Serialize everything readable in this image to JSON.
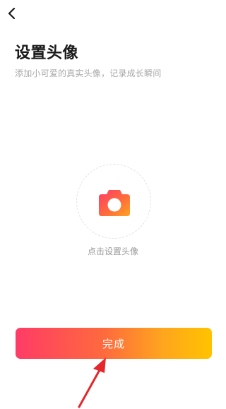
{
  "nav": {
    "back_icon": "chevron-left-icon"
  },
  "header": {
    "title": "设置头像",
    "subtitle": "添加小可爱的真实头像，记录成长瞬间"
  },
  "avatar": {
    "icon": "camera-icon",
    "hint": "点击设置头像"
  },
  "actions": {
    "done_label": "完成",
    "gradient_colors": [
      "#ff3b67",
      "#ff6a3d",
      "#ffa51e",
      "#ffc300"
    ]
  },
  "annotation": {
    "arrow_color": "#e5262b"
  }
}
